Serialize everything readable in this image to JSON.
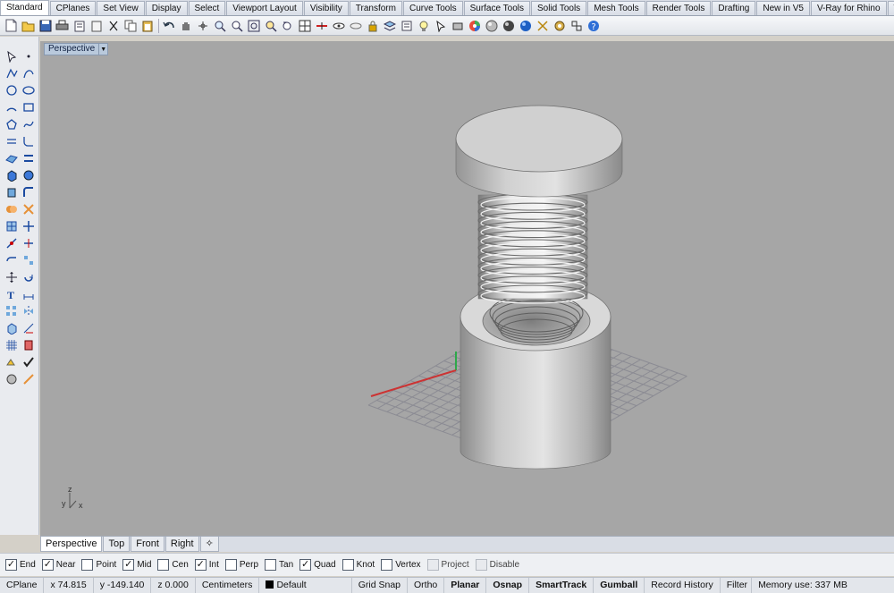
{
  "ribbon_tabs": [
    "Standard",
    "CPlanes",
    "Set View",
    "Display",
    "Select",
    "Viewport Layout",
    "Visibility",
    "Transform",
    "Curve Tools",
    "Surface Tools",
    "Solid Tools",
    "Mesh Tools",
    "Render Tools",
    "Drafting",
    "New in V5",
    "V-Ray for Rhino",
    "V-Ray ©"
  ],
  "viewport": {
    "title": "Perspective",
    "axis_labels": {
      "y": "y",
      "x": "x",
      "z": "z"
    }
  },
  "viewport_tabs": [
    "Perspective",
    "Top",
    "Front",
    "Right"
  ],
  "osnaps": [
    {
      "label": "End",
      "checked": true,
      "enabled": true
    },
    {
      "label": "Near",
      "checked": true,
      "enabled": true
    },
    {
      "label": "Point",
      "checked": false,
      "enabled": true
    },
    {
      "label": "Mid",
      "checked": true,
      "enabled": true
    },
    {
      "label": "Cen",
      "checked": false,
      "enabled": true
    },
    {
      "label": "Int",
      "checked": true,
      "enabled": true
    },
    {
      "label": "Perp",
      "checked": false,
      "enabled": true
    },
    {
      "label": "Tan",
      "checked": false,
      "enabled": true
    },
    {
      "label": "Quad",
      "checked": true,
      "enabled": true
    },
    {
      "label": "Knot",
      "checked": false,
      "enabled": true
    },
    {
      "label": "Vertex",
      "checked": false,
      "enabled": true
    },
    {
      "label": "Project",
      "checked": false,
      "enabled": false
    },
    {
      "label": "Disable",
      "checked": false,
      "enabled": false
    }
  ],
  "status": {
    "cplane": "CPlane",
    "x": "x 74.815",
    "y": "y -149.140",
    "z": "z 0.000",
    "units": "Centimeters",
    "layer": "Default",
    "grid_snap": "Grid Snap",
    "ortho": "Ortho",
    "planar": "Planar",
    "osnap": "Osnap",
    "smarttrack": "SmartTrack",
    "gumball": "Gumball",
    "record_history": "Record History",
    "filter": "Filter",
    "memory": "Memory use: 337 MB"
  }
}
